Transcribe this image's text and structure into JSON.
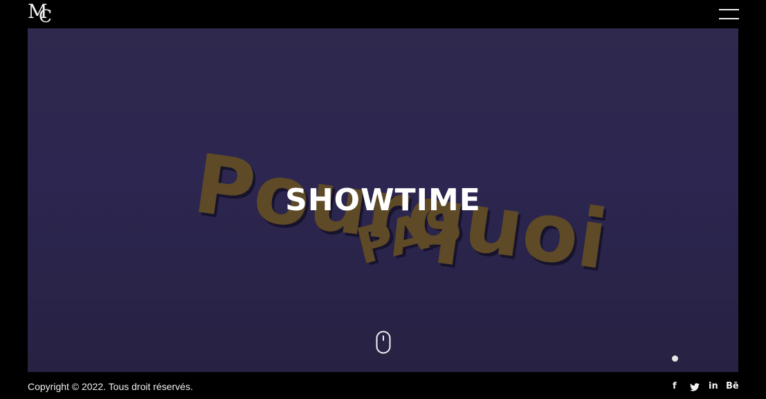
{
  "header": {
    "logo": {
      "m": "M",
      "c": "C"
    },
    "menu_icon": "hamburger-icon"
  },
  "hero": {
    "title": "SHOWTIME",
    "artwork_text": {
      "line1": "Pourquoi",
      "line2": "PAS"
    },
    "scroll_icon": "mouse-scroll-icon",
    "colors": {
      "background": "#2d2750",
      "artwork": "#5e4a26",
      "artwork_shadow": "#15112a"
    }
  },
  "footer": {
    "copyright": "Copyright © 2022. Tous droit réservés.",
    "socials": [
      {
        "name": "facebook",
        "label": "f"
      },
      {
        "name": "twitter",
        "label": ""
      },
      {
        "name": "linkedin",
        "label": "in"
      },
      {
        "name": "behance",
        "label": "Bē"
      }
    ]
  }
}
